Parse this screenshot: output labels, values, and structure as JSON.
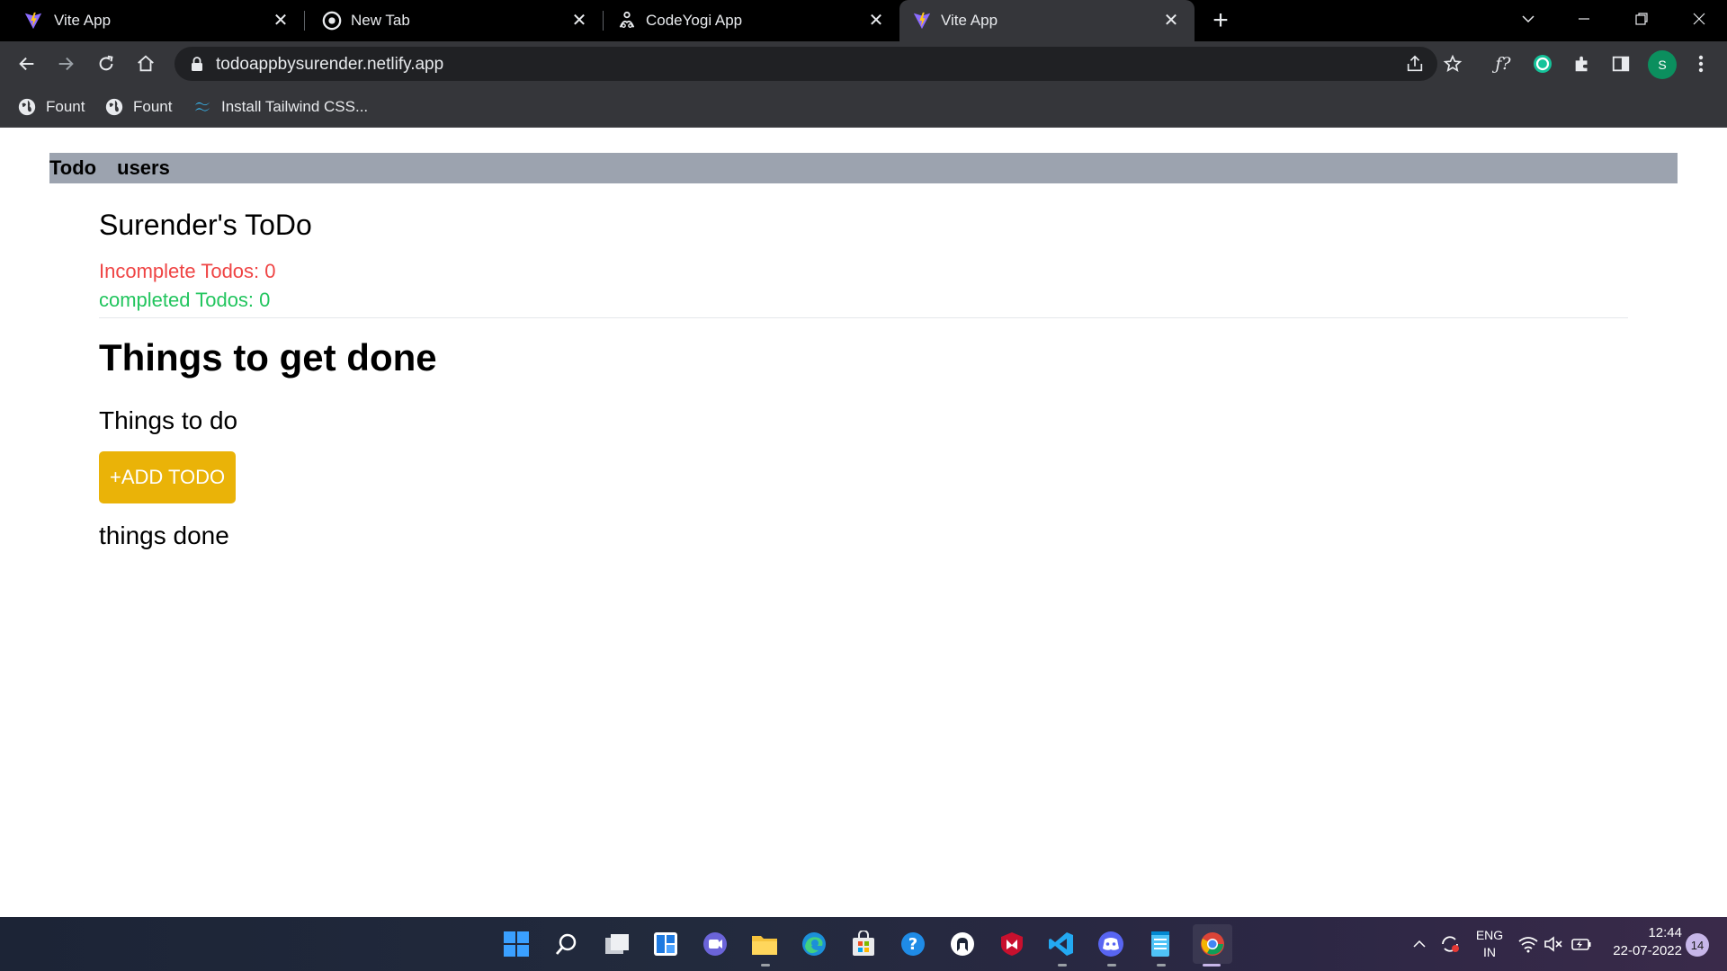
{
  "browser": {
    "tabs": [
      {
        "title": "Vite App",
        "icon": "vite-icon"
      },
      {
        "title": "New Tab",
        "icon": "chrome-icon"
      },
      {
        "title": "CodeYogi App",
        "icon": "codeyogi-icon"
      },
      {
        "title": "Vite App",
        "icon": "vite-icon",
        "active": true
      }
    ],
    "address": "todoappbysurender.netlify.app",
    "bookmarks": [
      {
        "label": "Fount",
        "icon": "globe-icon"
      },
      {
        "label": "Fount",
        "icon": "globe-icon"
      },
      {
        "label": "Install Tailwind CSS...",
        "icon": "tailwind-icon"
      }
    ],
    "profile_initial": "S"
  },
  "page": {
    "nav": [
      "Todo",
      "users"
    ],
    "todo_title": "Surender's ToDo",
    "incomplete_label": "Incomplete Todos: 0",
    "completed_label": "completed Todos: 0",
    "main_heading": "Things to get done",
    "todo_section": "Things to do",
    "add_button": "+ADD TODO",
    "done_section": "things done",
    "colors": {
      "nav_bg": "#9ca3af",
      "incomplete": "#ef4444",
      "completed": "#22c55e",
      "button": "#eab308"
    }
  },
  "taskbar": {
    "lang_top": "ENG",
    "lang_bottom": "IN",
    "time": "12:44",
    "date": "22-07-2022",
    "notifications": "14"
  }
}
